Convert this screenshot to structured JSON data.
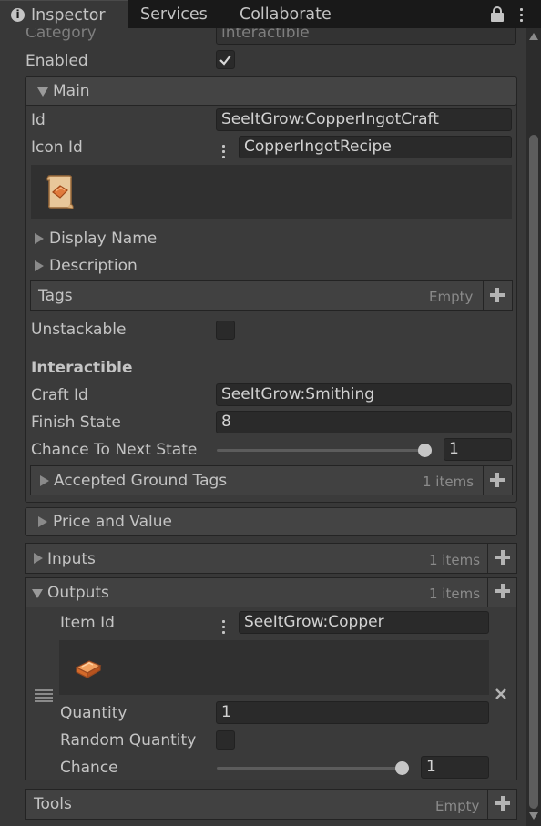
{
  "tabs": {
    "inspector": "Inspector",
    "services": "Services",
    "collaborate": "Collaborate"
  },
  "top": {
    "category_label": "Category",
    "category_value": "interactible",
    "enabled_label": "Enabled",
    "enabled_checked": true
  },
  "main": {
    "title": "Main",
    "id_label": "Id",
    "id_value": "SeeItGrow:CopperIngotCraft",
    "icon_id_label": "Icon Id",
    "icon_id_value": "CopperIngotRecipe",
    "icon_name": "recipe-scroll-icon",
    "display_name_label": "Display Name",
    "description_label": "Description",
    "tags_label": "Tags",
    "tags_count": "Empty",
    "unstackable_label": "Unstackable",
    "unstackable_checked": false,
    "interactible_header": "Interactible",
    "craft_id_label": "Craft Id",
    "craft_id_value": "SeeItGrow:Smithing",
    "finish_state_label": "Finish State",
    "finish_state_value": "8",
    "chance_label": "Chance To Next State",
    "chance_value": "1",
    "chance_slider_fraction": 1.0,
    "accepted_tags_label": "Accepted Ground Tags",
    "accepted_tags_count": "1 items"
  },
  "price": {
    "title": "Price and Value"
  },
  "inputs": {
    "title": "Inputs",
    "count": "1 items"
  },
  "outputs": {
    "title": "Outputs",
    "count": "1 items",
    "item_id_label": "Item Id",
    "item_id_value": "SeeItGrow:Copper",
    "item_icon_name": "copper-ingot-icon",
    "quantity_label": "Quantity",
    "quantity_value": "1",
    "random_quantity_label": "Random Quantity",
    "random_quantity_checked": false,
    "chance_label": "Chance",
    "chance_value": "1",
    "chance_slider_fraction": 1.0
  },
  "tools": {
    "title": "Tools",
    "count": "Empty"
  },
  "colors": {
    "panel_bg": "#383838",
    "field_bg": "#2a2a2a",
    "foldout_bg": "#444444",
    "tab_bar_bg": "#191919"
  }
}
